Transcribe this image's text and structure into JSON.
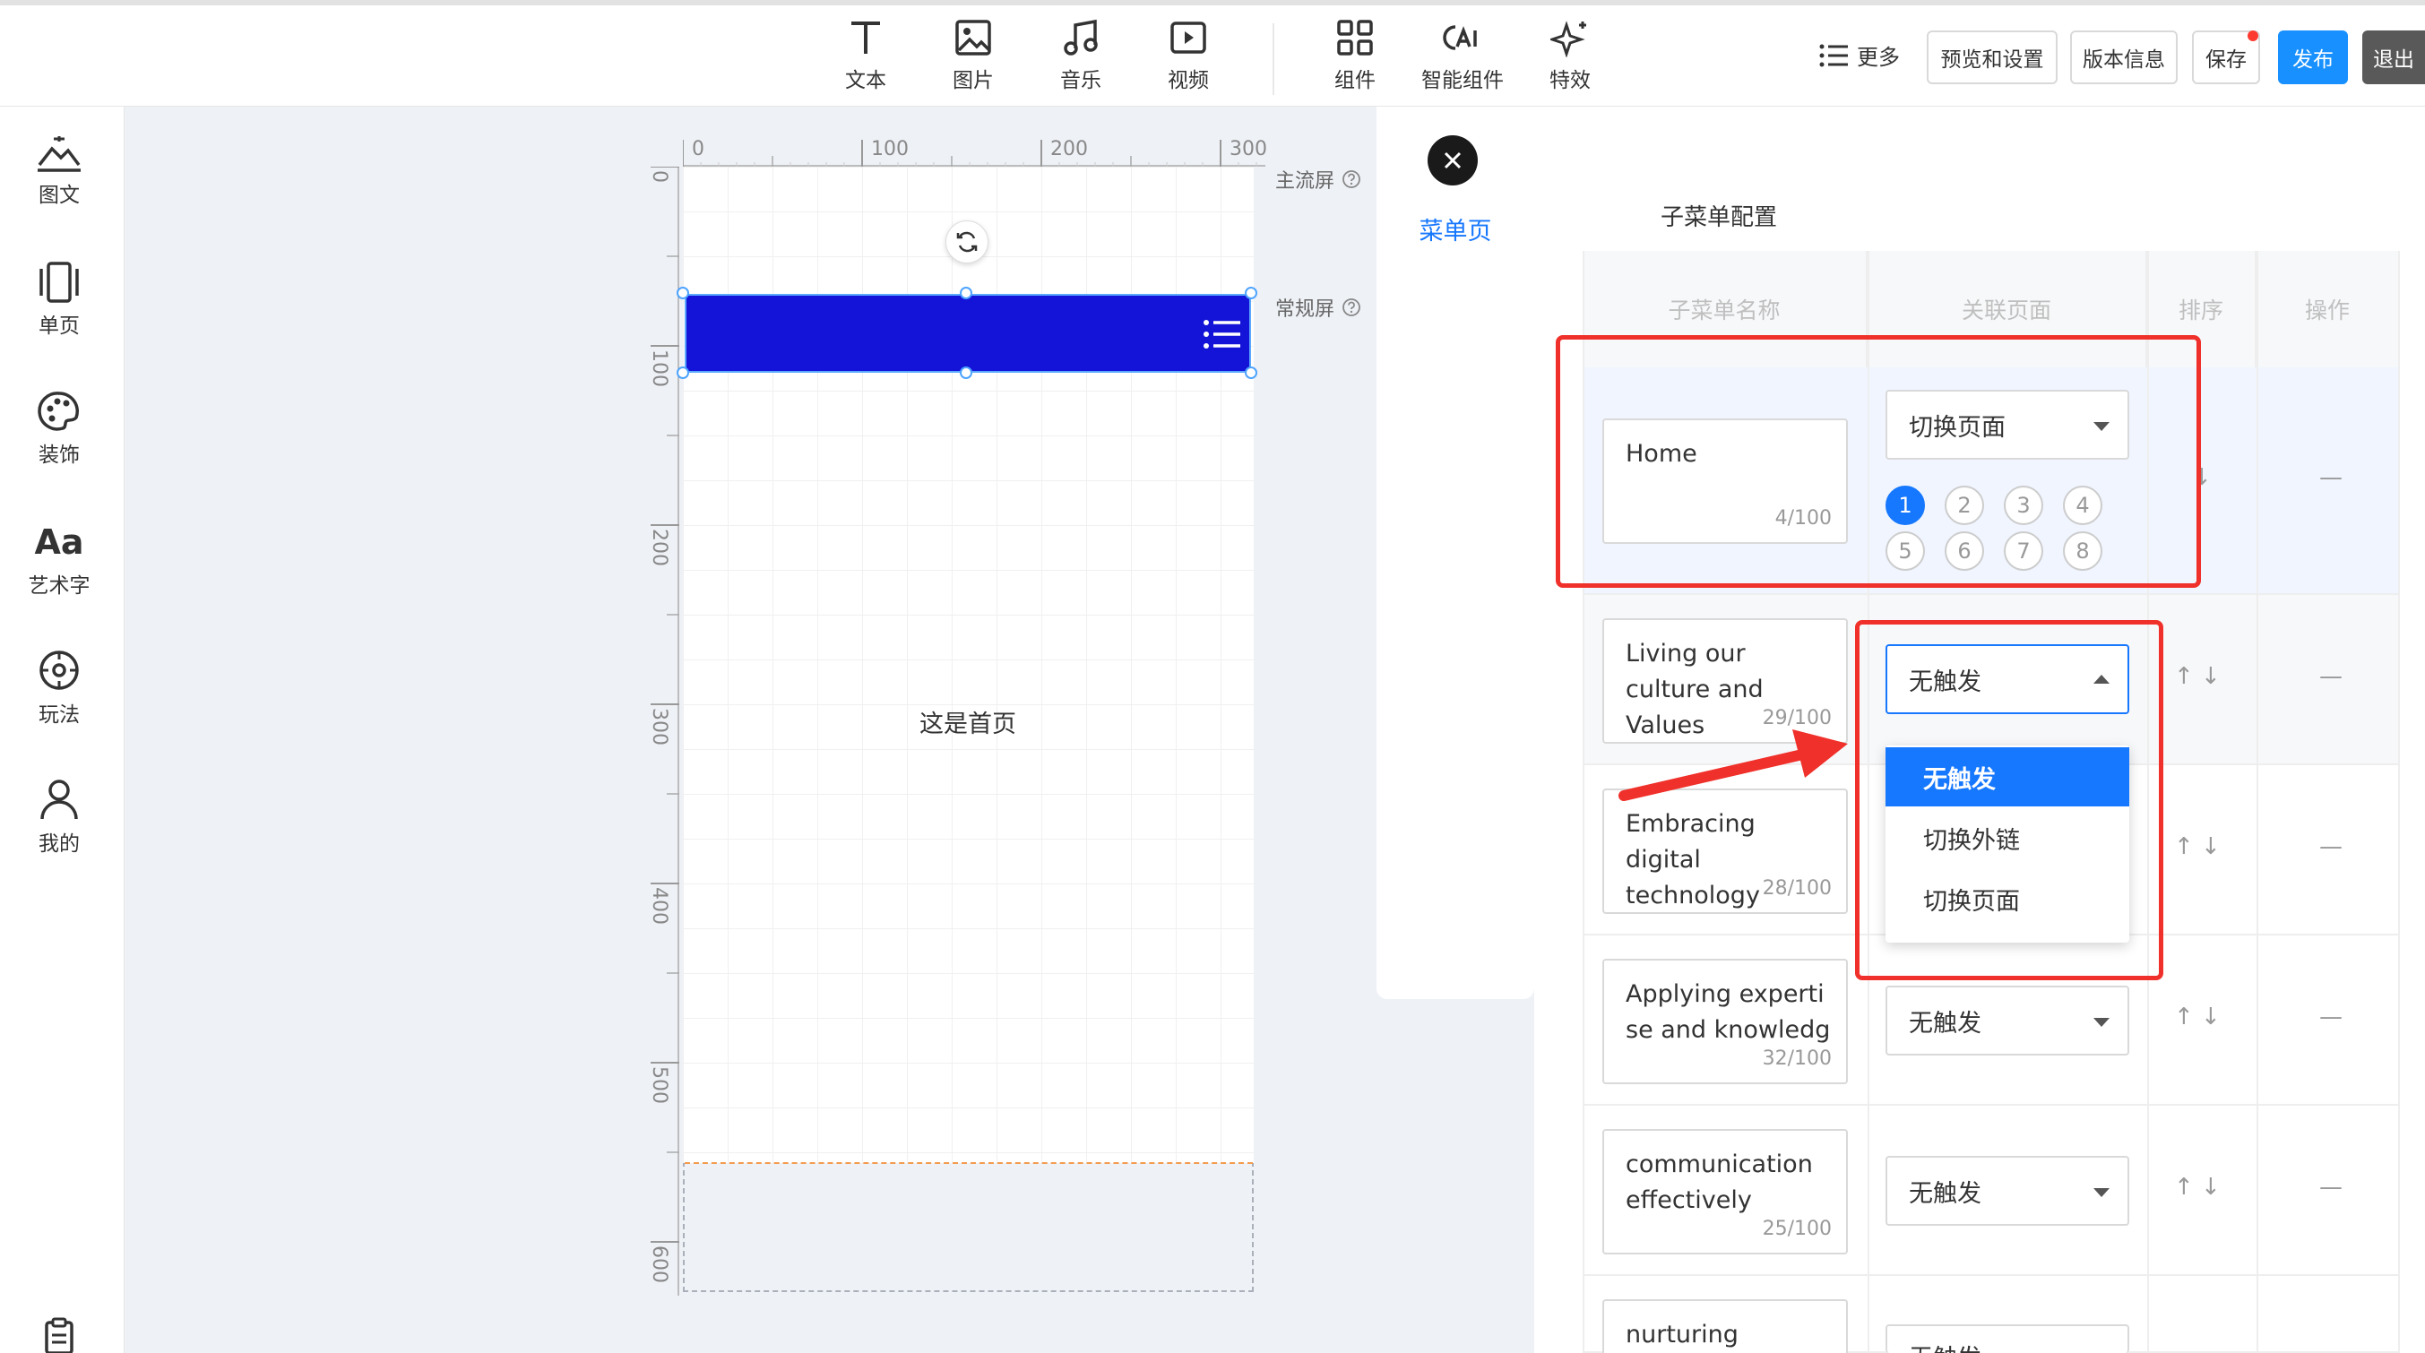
{
  "toolbar": {
    "tools": [
      {
        "icon": "text-icon",
        "label": "文本"
      },
      {
        "icon": "image-icon",
        "label": "图片"
      },
      {
        "icon": "music-icon",
        "label": "音乐"
      },
      {
        "icon": "video-icon",
        "label": "视频"
      },
      {
        "icon": "component-icon",
        "label": "组件"
      },
      {
        "icon": "ai-component-icon",
        "label": "智能组件"
      },
      {
        "icon": "effects-icon",
        "label": "特效"
      }
    ],
    "more_label": "更多",
    "preview_label": "预览和设置",
    "version_label": "版本信息",
    "save_label": "保存",
    "publish_label": "发布",
    "exit_label": "退出"
  },
  "sidebar": {
    "items": [
      {
        "icon": "graphic-text-icon",
        "label": "图文"
      },
      {
        "icon": "single-page-icon",
        "label": "单页"
      },
      {
        "icon": "palette-icon",
        "label": "装饰"
      },
      {
        "icon": "art-font-icon",
        "label": "艺术字"
      },
      {
        "icon": "gameplay-icon",
        "label": "玩法"
      },
      {
        "icon": "user-icon",
        "label": "我的"
      }
    ]
  },
  "canvas": {
    "ruler_top": [
      "0",
      "100",
      "200",
      "300"
    ],
    "ruler_left": [
      "0",
      "100",
      "200",
      "300",
      "400",
      "500",
      "600"
    ],
    "main_screen_label": "主流屏",
    "normal_screen_label": "常规屏",
    "page_text": "这是首页"
  },
  "menu_panel": {
    "label": "菜单页"
  },
  "config": {
    "title": "子菜单配置",
    "headers": [
      "子菜单名称",
      "关联页面",
      "排序",
      "操作"
    ],
    "rows": [
      {
        "name": "Home",
        "count": "4/100",
        "select": "切换页面",
        "pages": [
          "1",
          "2",
          "3",
          "4",
          "5",
          "6",
          "7",
          "8"
        ],
        "active_page": "1",
        "sort": "↓",
        "op": "—"
      },
      {
        "name": "Living our culture and Values",
        "count": "29/100",
        "select": "无触发",
        "sort": "↑ ↓",
        "op": "—"
      },
      {
        "name": "Embracing digital technology",
        "count": "28/100",
        "select": "",
        "sort": "↑ ↓",
        "op": "—"
      },
      {
        "name": "Applying expertise and knowledge",
        "count": "32/100",
        "select": "无触发",
        "sort": "↑ ↓",
        "op": "—"
      },
      {
        "name": "communication effectively",
        "count": "25/100",
        "select": "无触发",
        "sort": "↑ ↓",
        "op": "—"
      },
      {
        "name": "nurturing diverse",
        "count": "",
        "select": "无触发",
        "sort": "↑ ↓",
        "op": "—"
      }
    ],
    "dropdown_options": [
      "无触发",
      "切换外链",
      "切换页面"
    ],
    "dropdown_selected": "无触发"
  },
  "colors": {
    "accent": "#1677ff",
    "nav_bar": "#1414d8",
    "annotation": "#f0302a",
    "exit": "#595959"
  }
}
